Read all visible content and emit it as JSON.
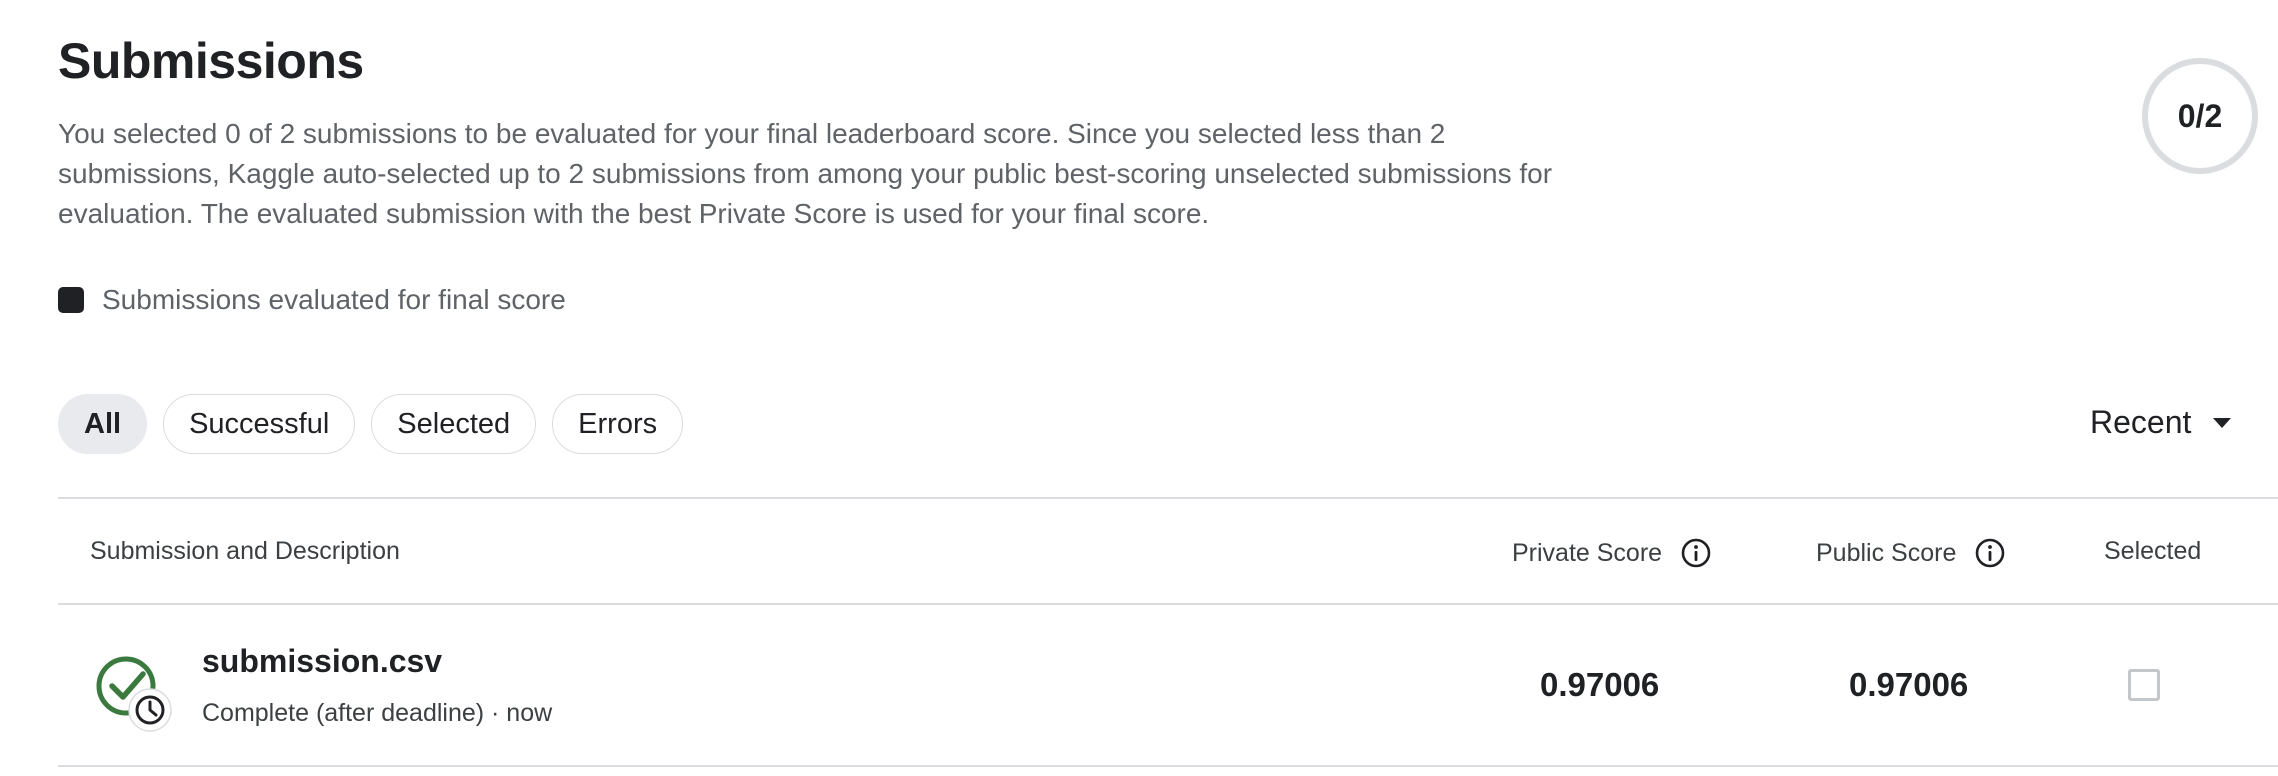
{
  "page": {
    "title": "Submissions",
    "description": "You selected 0 of 2 submissions to be evaluated for your final leaderboard score. Since you selected less than 2 submissions, Kaggle auto-selected up to 2 submissions from among your public best-scoring unselected submissions for evaluation. The evaluated submission with the best Private Score is used for your final score.",
    "selection_progress": "0/2",
    "legend_label": "Submissions evaluated for final score"
  },
  "filters": {
    "chips": [
      "All",
      "Successful",
      "Selected",
      "Errors"
    ],
    "active": "All"
  },
  "sort": {
    "label": "Recent",
    "icon": "caret-down-icon"
  },
  "table": {
    "headers": {
      "submission": "Submission and Description",
      "private_score": "Private Score",
      "public_score": "Public Score",
      "selected": "Selected"
    },
    "rows": [
      {
        "file_name": "submission.csv",
        "status": "Complete (after deadline) · now",
        "private_score": "0.97006",
        "public_score": "0.97006",
        "selected": false,
        "status_icon": "check-clock-icon"
      }
    ]
  },
  "colors": {
    "accent_green": "#3b7a3f",
    "text": "#202124",
    "muted": "#5f6368",
    "border": "#dadce0"
  }
}
